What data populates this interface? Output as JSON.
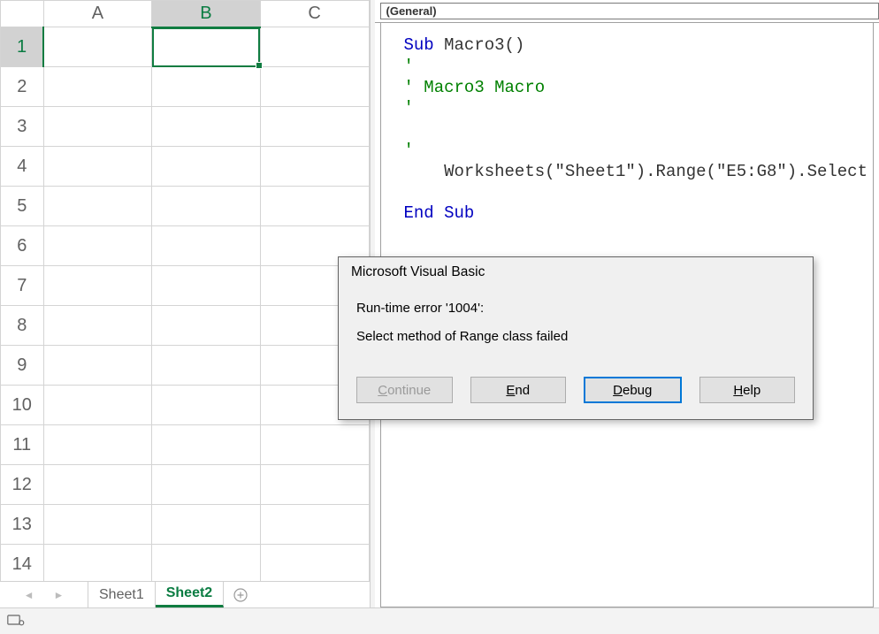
{
  "sheet": {
    "columns": [
      "A",
      "B",
      "C"
    ],
    "rows": [
      "1",
      "2",
      "3",
      "4",
      "5",
      "6",
      "7",
      "8",
      "9",
      "10",
      "11",
      "12",
      "13",
      "14"
    ],
    "selected_col_idx": 1,
    "selected_row_idx": 0,
    "tabs": [
      {
        "label": "Sheet1",
        "active": false
      },
      {
        "label": "Sheet2",
        "active": true
      }
    ]
  },
  "vbe": {
    "dropdown_label": "(General)",
    "code": {
      "l1_kw": "Sub ",
      "l1_rest": "Macro3()",
      "l2_cm": "'",
      "l3_cm": "' Macro3 Macro",
      "l4_cm": "'",
      "l5_blank": "",
      "l6_cm": "'",
      "l7_body": "    Worksheets(\"Sheet1\").Range(\"E5:G8\").Select",
      "l8_blank": "",
      "l9_kw": "End Sub"
    }
  },
  "dialog": {
    "title": "Microsoft Visual Basic",
    "line1": "Run-time error '1004':",
    "line2": "Select method of Range class failed",
    "buttons": {
      "continue": "Continue",
      "end": "End",
      "debug": "Debug",
      "help": "Help"
    }
  }
}
